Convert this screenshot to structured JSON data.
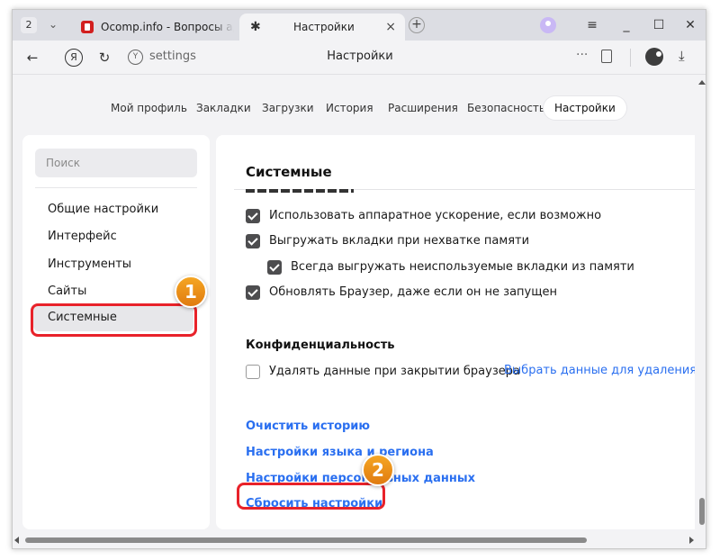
{
  "browser": {
    "tab_count": "2",
    "tabs": [
      {
        "title": "Ocomp.info - Вопросы адм",
        "active": false,
        "icon": "ocomp-favicon"
      },
      {
        "title": "Настройки",
        "active": true,
        "icon": "gear-icon"
      }
    ],
    "tab_close_glyph": "×",
    "new_tab_glyph": "+",
    "window_controls": {
      "menu": "≡",
      "minimize": "_",
      "maximize": "☐",
      "close": "✕"
    }
  },
  "navbar": {
    "back_glyph": "←",
    "ya_glyph": "Я",
    "reload_glyph": "↻",
    "omnibox_icon_glyph": "Y",
    "url": "settings",
    "page_title": "Настройки",
    "more_glyph": "···",
    "download_glyph": "⤓"
  },
  "settings_nav": [
    {
      "label": "Мой профиль",
      "active": false
    },
    {
      "label": "Закладки",
      "active": false
    },
    {
      "label": "Загрузки",
      "active": false
    },
    {
      "label": "История",
      "active": false
    },
    {
      "label": "Расширения",
      "active": false
    },
    {
      "label": "Безопасность",
      "active": false
    },
    {
      "label": "Настройки",
      "active": true
    }
  ],
  "sidebar": {
    "search_placeholder": "Поиск",
    "items": [
      {
        "label": "Общие настройки",
        "selected": false
      },
      {
        "label": "Интерфейс",
        "selected": false
      },
      {
        "label": "Инструменты",
        "selected": false
      },
      {
        "label": "Сайты",
        "selected": false
      },
      {
        "label": "Системные",
        "selected": true
      }
    ]
  },
  "main": {
    "section_title": "Системные",
    "checkboxes": [
      {
        "label": "Использовать аппаратное ускорение, если возможно",
        "checked": true
      },
      {
        "label": "Выгружать вкладки при нехватке памяти",
        "checked": true
      },
      {
        "label": "Всегда выгружать неиспользуемые вкладки из памяти",
        "checked": true
      },
      {
        "label": "Обновлять Браузер, даже если он не запущен",
        "checked": true
      }
    ],
    "privacy": {
      "title": "Конфиденциальность",
      "delete_on_close_label": "Удалять данные при закрытии браузера",
      "delete_on_close_checked": false,
      "choose_data_link": "Выбрать данные для удаления"
    },
    "links": [
      "Очистить историю",
      "Настройки языка и региона",
      "Настройки персональных данных",
      "Сбросить настройки"
    ]
  },
  "annotations": {
    "badge_1": "1",
    "badge_2": "2",
    "color": "#e8222a",
    "badge_color": "#f39a1b"
  }
}
